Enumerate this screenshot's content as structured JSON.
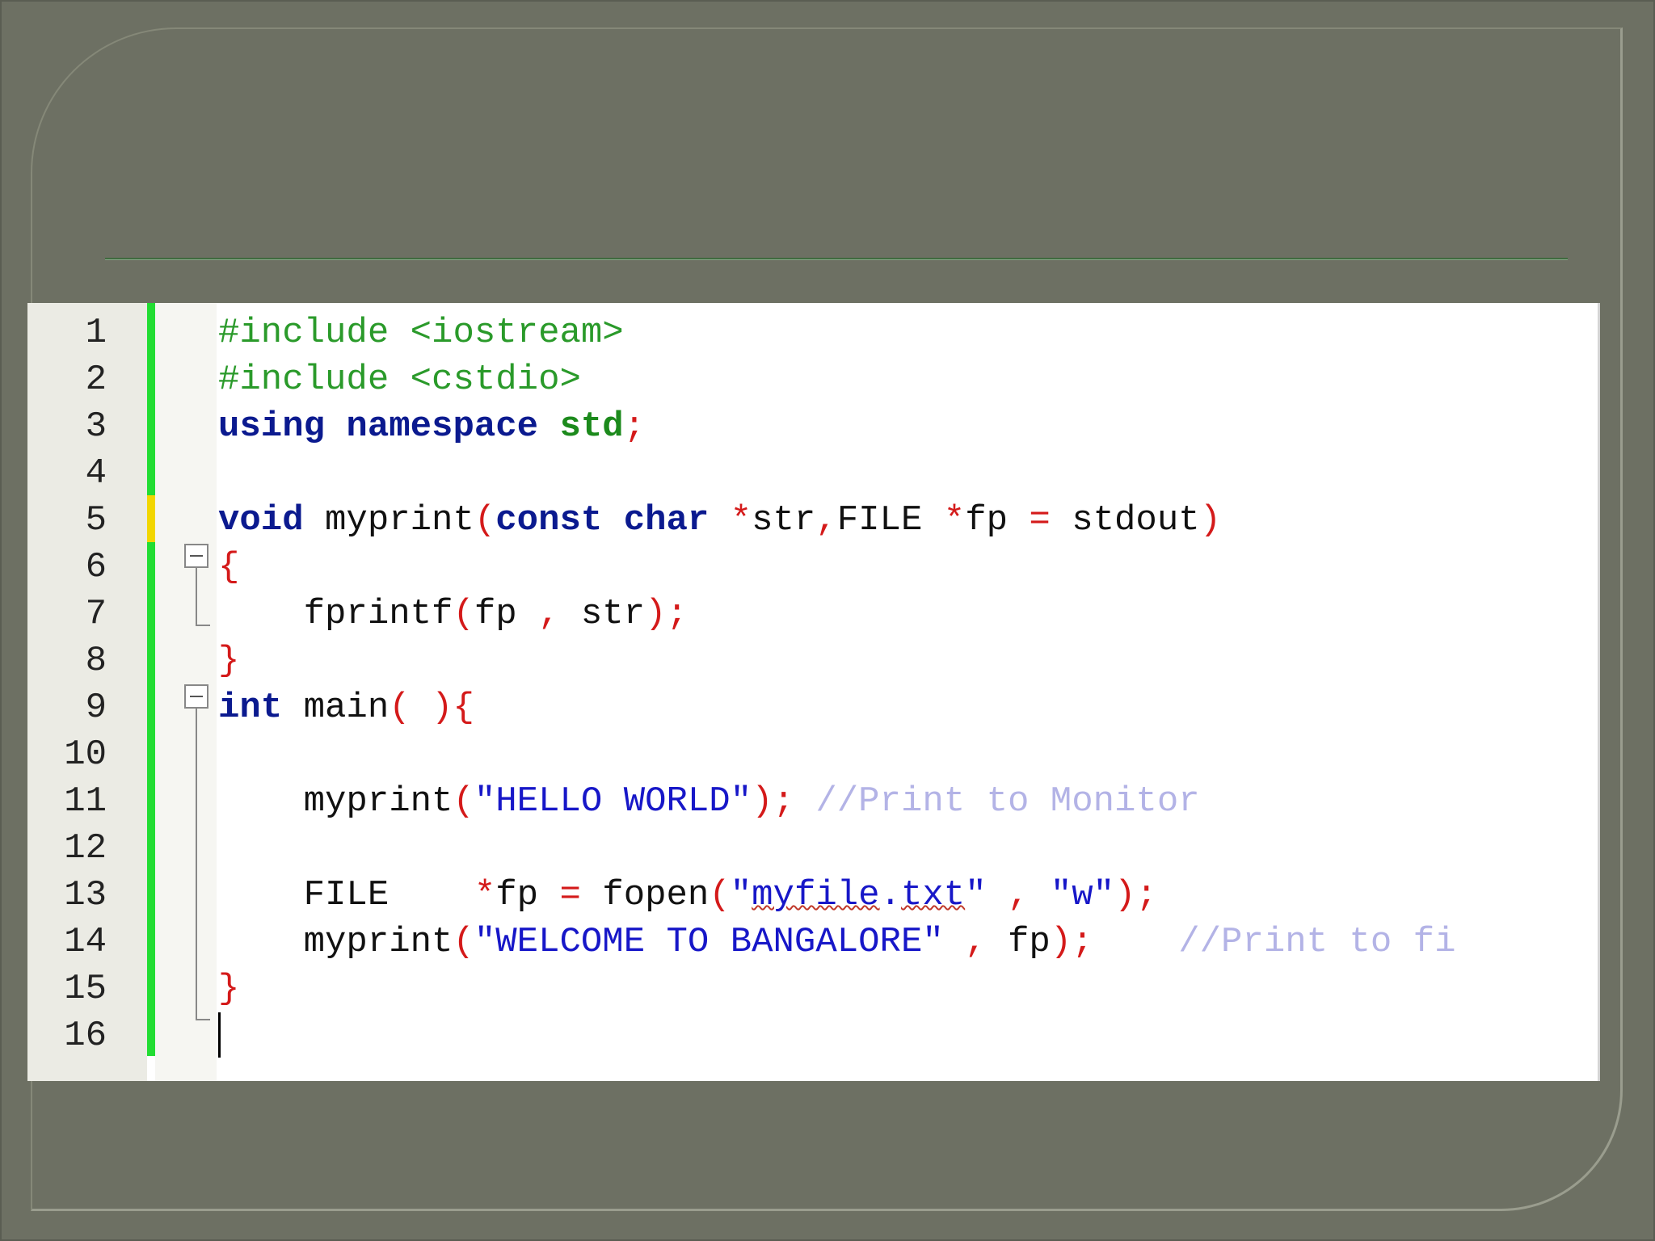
{
  "editor": {
    "line_numbers": [
      "1",
      "2",
      "3",
      "4",
      "5",
      "6",
      "7",
      "8",
      "9",
      "10",
      "11",
      "12",
      "13",
      "14",
      "15",
      "16"
    ],
    "lines": {
      "l1": {
        "pp": "#include <iostream>"
      },
      "l2": {
        "pp": "#include <cstdio>"
      },
      "l3": {
        "kw1": "using namespace ",
        "ns": "std",
        "op": ";"
      },
      "l5": {
        "kw_void": "void",
        "t1": " myprint",
        "p1": "(",
        "kw_const": "const char ",
        "op1": "*",
        "t2": "str",
        "op2": ",",
        "t3": "FILE ",
        "op3": "*",
        "t4": "fp ",
        "op4": "=",
        "t5": " stdout",
        "p2": ")"
      },
      "l6": {
        "op": "{"
      },
      "l7": {
        "t1": "    fprintf",
        "p1": "(",
        "t2": "fp ",
        "op1": ",",
        "t3": " str",
        "p2": ");"
      },
      "l8": {
        "op": "}"
      },
      "l9": {
        "kw": "int",
        "t1": " main",
        "p1": "( ){"
      },
      "l11": {
        "t1": "    myprint",
        "p1": "(",
        "str": "\"HELLO WORLD\"",
        "p2": ");",
        "sp": " ",
        "cmt": "//Print to Monitor"
      },
      "l13": {
        "t1": "    FILE    ",
        "op1": "*",
        "t2": "fp ",
        "op2": "=",
        "t3": " fopen",
        "p1": "(",
        "str_q1": "\"",
        "str_w1": "myfile",
        "str_dot": ".",
        "str_w2": "txt",
        "str_q2": "\"",
        "sp1": " ",
        "op3": ",",
        "sp2": " ",
        "str2": "\"w\"",
        "p2": ");"
      },
      "l14": {
        "t1": "    myprint",
        "p1": "(",
        "str": "\"WELCOME TO BANGALORE\"",
        "sp1": " ",
        "op1": ",",
        "t2": " fp",
        "p2": ");",
        "sp2": "    ",
        "cmt": "//Print to fi"
      },
      "l15": {
        "op": "}"
      }
    }
  },
  "colors": {
    "background": "#6d7063",
    "preprocessor": "#2a9a2a",
    "keyword": "#0b1a8f",
    "operator": "#d41a1a",
    "string": "#1717c8",
    "comment": "#b3b3e6",
    "change_saved": "#22dd33",
    "change_unsaved": "#f2d600"
  }
}
